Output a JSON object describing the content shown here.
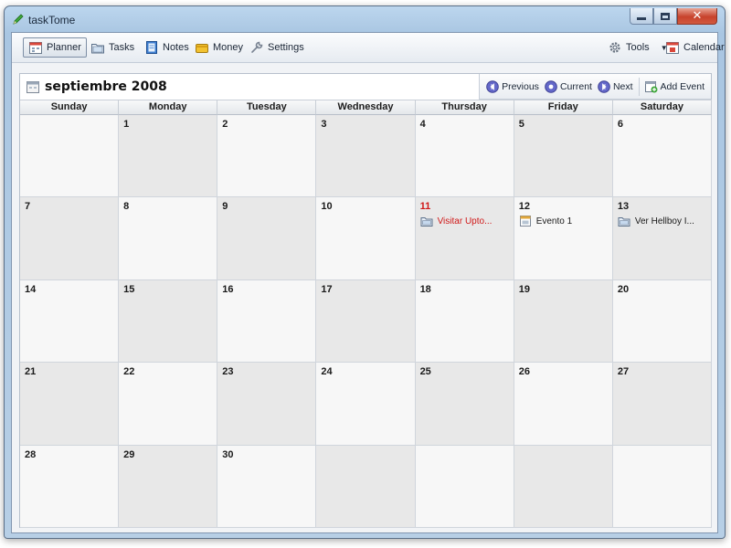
{
  "window": {
    "title": "taskTome",
    "app_icon": "pencil-icon"
  },
  "toolbar": {
    "left": [
      {
        "label": "Planner",
        "icon": "planner-icon",
        "active": true
      },
      {
        "label": "Tasks",
        "icon": "tasks-icon"
      },
      {
        "label": "Notes",
        "icon": "notes-icon"
      },
      {
        "label": "Money",
        "icon": "money-icon"
      },
      {
        "label": "Settings",
        "icon": "settings-wrench-icon"
      }
    ],
    "tools_label": "Tools",
    "calendar_label": "Calendar"
  },
  "calendar": {
    "month_title": "septiembre 2008",
    "nav": {
      "previous": "Previous",
      "current": "Current",
      "next": "Next",
      "add_event": "Add Event"
    },
    "weekdays": [
      "Sunday",
      "Monday",
      "Tuesday",
      "Wednesday",
      "Thursday",
      "Friday",
      "Saturday"
    ],
    "weeks": [
      [
        {
          "d": ""
        },
        {
          "d": "1"
        },
        {
          "d": "2"
        },
        {
          "d": "3"
        },
        {
          "d": "4"
        },
        {
          "d": "5"
        },
        {
          "d": "6"
        }
      ],
      [
        {
          "d": "7"
        },
        {
          "d": "8"
        },
        {
          "d": "9"
        },
        {
          "d": "10"
        },
        {
          "d": "11",
          "today": true,
          "events": [
            {
              "title": "Visitar Upto...",
              "icon": "folder-event-icon",
              "red": true
            }
          ]
        },
        {
          "d": "12",
          "events": [
            {
              "title": "Evento 1",
              "icon": "calendar-event-icon"
            }
          ]
        },
        {
          "d": "13",
          "events": [
            {
              "title": "Ver Hellboy I...",
              "icon": "folder-event-icon"
            }
          ]
        }
      ],
      [
        {
          "d": "14"
        },
        {
          "d": "15"
        },
        {
          "d": "16"
        },
        {
          "d": "17"
        },
        {
          "d": "18"
        },
        {
          "d": "19"
        },
        {
          "d": "20"
        }
      ],
      [
        {
          "d": "21"
        },
        {
          "d": "22"
        },
        {
          "d": "23"
        },
        {
          "d": "24"
        },
        {
          "d": "25"
        },
        {
          "d": "26"
        },
        {
          "d": "27"
        }
      ],
      [
        {
          "d": "28"
        },
        {
          "d": "29"
        },
        {
          "d": "30"
        },
        {
          "d": ""
        },
        {
          "d": ""
        },
        {
          "d": ""
        },
        {
          "d": ""
        }
      ]
    ]
  },
  "colors": {
    "today": "#d01818",
    "cell_light": "#f7f7f7",
    "cell_dark": "#e8e8e8",
    "nav_button": "#5b5fc7"
  }
}
